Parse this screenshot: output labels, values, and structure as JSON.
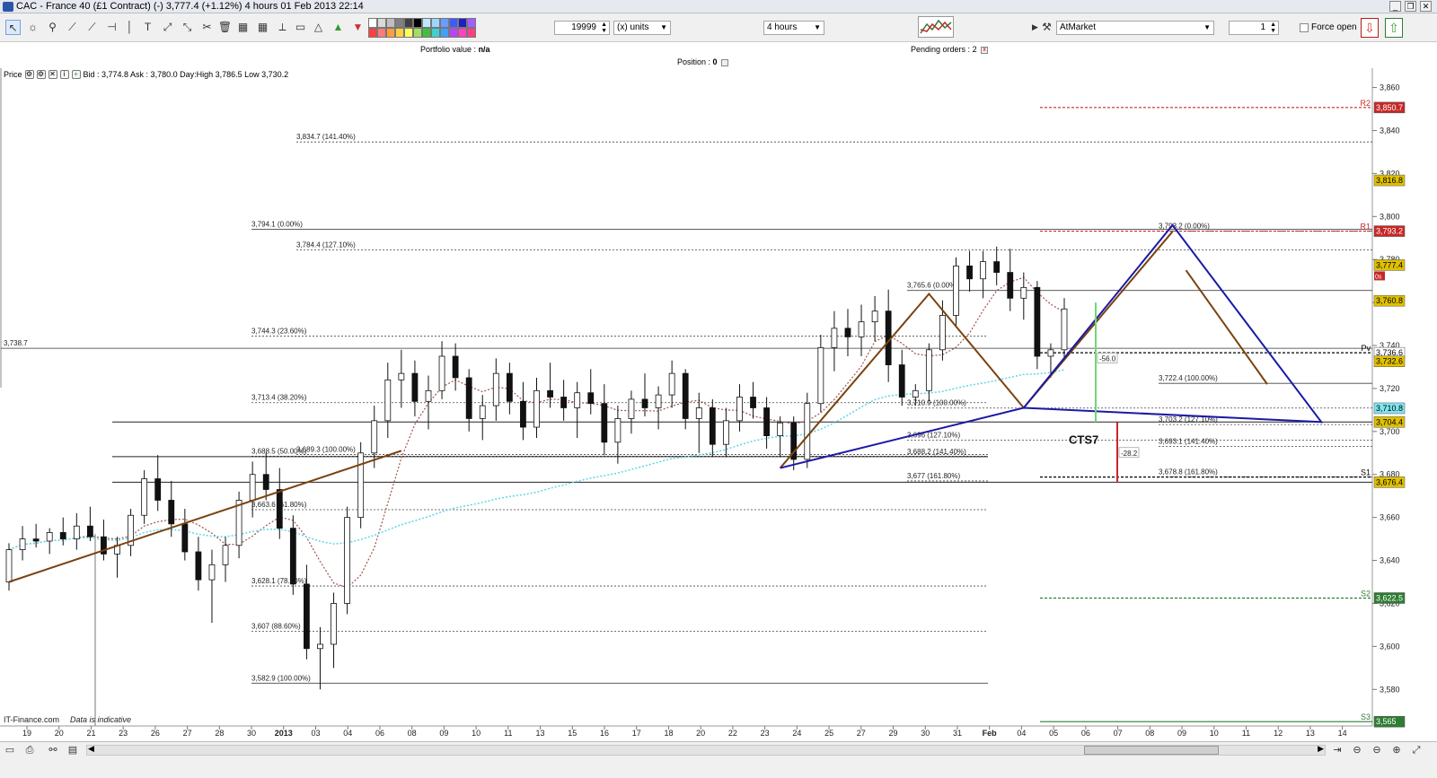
{
  "window": {
    "title": "CAC - France 40 (£1 Contract) (-)    3,777.4 (+1.12%)    4 hours  01 Feb 2013 22:14"
  },
  "toolbar": {
    "quantity": "19999",
    "units": "(x) units",
    "timeframe": "4 hours",
    "order_type": "AtMarket",
    "order_qty": "1",
    "force_open": "Force open"
  },
  "status": {
    "portfolio_label": "Portfolio value :",
    "portfolio_value": "n/a",
    "pending_label": "Pending orders :",
    "pending_value": "2",
    "position_label": "Position :",
    "position_value": "0"
  },
  "chart_header": {
    "label": "Price",
    "quote": "Bid : 3,774.8 Ask : 3,780.0 Day:High 3,786.5 Low 3,730.2"
  },
  "watermark": {
    "brand": "IT-Finance.com",
    "note": "Data is indicative"
  },
  "chart_data": {
    "type": "candlestick",
    "instrument": "CAC - France 40 (£1 Contract)",
    "timeframe": "4 hours",
    "y_ticks": [
      3580,
      3600,
      3620,
      3640,
      3660,
      3680,
      3700,
      3720,
      3740,
      3760,
      3780,
      3800,
      3820,
      3840,
      3860
    ],
    "y_tick_labels": [
      "3,580",
      "3,600",
      "3,620",
      "3,640",
      "3,660",
      "3,680",
      "3,700",
      "3,720",
      "3,740",
      "3,760",
      "3,780",
      "3,800",
      "3,820",
      "3,840",
      "3,860"
    ],
    "ylim": [
      3563,
      3869
    ],
    "x_labels": [
      "19",
      "20",
      "21",
      "23",
      "26",
      "27",
      "28",
      "30",
      "2013",
      "03",
      "04",
      "06",
      "08",
      "09",
      "10",
      "11",
      "13",
      "15",
      "16",
      "17",
      "18",
      "20",
      "22",
      "23",
      "24",
      "25",
      "27",
      "29",
      "30",
      "31",
      "Feb",
      "04",
      "05",
      "06",
      "07",
      "08",
      "09",
      "10",
      "11",
      "12",
      "13",
      "14"
    ],
    "candles": [
      [
        3630,
        3648,
        3626,
        3645
      ],
      [
        3645,
        3656,
        3640,
        3650
      ],
      [
        3650,
        3657,
        3646,
        3649
      ],
      [
        3649,
        3655,
        3643,
        3653
      ],
      [
        3653,
        3660,
        3647,
        3650
      ],
      [
        3650,
        3662,
        3645,
        3656
      ],
      [
        3656,
        3665,
        3649,
        3651
      ],
      [
        3651,
        3659,
        3640,
        3643
      ],
      [
        3643,
        3651,
        3632,
        3647
      ],
      [
        3647,
        3664,
        3642,
        3661
      ],
      [
        3661,
        3682,
        3657,
        3678
      ],
      [
        3678,
        3689,
        3663,
        3668
      ],
      [
        3668,
        3677,
        3651,
        3657
      ],
      [
        3657,
        3664,
        3640,
        3644
      ],
      [
        3644,
        3651,
        3626,
        3631
      ],
      [
        3631,
        3645,
        3611,
        3638
      ],
      [
        3638,
        3651,
        3630,
        3647
      ],
      [
        3647,
        3672,
        3641,
        3668
      ],
      [
        3668,
        3686,
        3660,
        3680
      ],
      [
        3680,
        3690,
        3668,
        3673
      ],
      [
        3673,
        3683,
        3650,
        3655
      ],
      [
        3655,
        3661,
        3624,
        3629
      ],
      [
        3629,
        3638,
        3594,
        3599
      ],
      [
        3599,
        3609,
        3580,
        3601
      ],
      [
        3601,
        3625,
        3590,
        3620
      ],
      [
        3620,
        3665,
        3615,
        3660
      ],
      [
        3660,
        3695,
        3655,
        3690
      ],
      [
        3690,
        3712,
        3683,
        3705
      ],
      [
        3705,
        3732,
        3697,
        3724
      ],
      [
        3724,
        3738,
        3711,
        3727
      ],
      [
        3727,
        3733,
        3707,
        3714
      ],
      [
        3714,
        3726,
        3701,
        3719
      ],
      [
        3719,
        3742,
        3715,
        3735
      ],
      [
        3735,
        3741,
        3719,
        3725
      ],
      [
        3725,
        3729,
        3700,
        3706
      ],
      [
        3706,
        3717,
        3696,
        3712
      ],
      [
        3712,
        3734,
        3705,
        3727
      ],
      [
        3727,
        3732,
        3708,
        3714
      ],
      [
        3714,
        3723,
        3696,
        3702
      ],
      [
        3702,
        3725,
        3697,
        3719
      ],
      [
        3719,
        3732,
        3711,
        3716
      ],
      [
        3716,
        3724,
        3705,
        3711
      ],
      [
        3711,
        3723,
        3697,
        3718
      ],
      [
        3718,
        3729,
        3708,
        3713
      ],
      [
        3713,
        3722,
        3689,
        3695
      ],
      [
        3695,
        3712,
        3685,
        3706
      ],
      [
        3706,
        3719,
        3699,
        3715
      ],
      [
        3715,
        3727,
        3707,
        3711
      ],
      [
        3711,
        3721,
        3701,
        3717
      ],
      [
        3717,
        3733,
        3711,
        3727
      ],
      [
        3727,
        3729,
        3701,
        3706
      ],
      [
        3706,
        3718,
        3690,
        3711
      ],
      [
        3711,
        3715,
        3688,
        3694
      ],
      [
        3694,
        3711,
        3688,
        3705
      ],
      [
        3705,
        3722,
        3700,
        3716
      ],
      [
        3716,
        3723,
        3706,
        3711
      ],
      [
        3711,
        3716,
        3692,
        3698
      ],
      [
        3698,
        3707,
        3688,
        3704
      ],
      [
        3704,
        3707,
        3682,
        3687
      ],
      [
        3687,
        3718,
        3683,
        3713
      ],
      [
        3713,
        3745,
        3709,
        3739
      ],
      [
        3739,
        3756,
        3728,
        3748
      ],
      [
        3748,
        3757,
        3735,
        3744
      ],
      [
        3744,
        3759,
        3735,
        3751
      ],
      [
        3751,
        3763,
        3742,
        3756
      ],
      [
        3756,
        3766,
        3723,
        3731
      ],
      [
        3731,
        3738,
        3712,
        3716
      ],
      [
        3716,
        3722,
        3712,
        3719
      ],
      [
        3719,
        3741,
        3714,
        3738
      ],
      [
        3738,
        3761,
        3733,
        3754
      ],
      [
        3754,
        3781,
        3749,
        3777
      ],
      [
        3777,
        3784,
        3765,
        3771
      ],
      [
        3771,
        3784,
        3762,
        3779
      ],
      [
        3779,
        3786,
        3768,
        3774
      ],
      [
        3774,
        3785,
        3756,
        3762
      ],
      [
        3762,
        3774,
        3752,
        3767
      ],
      [
        3767,
        3770,
        3729,
        3735
      ],
      [
        3735,
        3741,
        3725,
        3738
      ],
      [
        3738,
        3762,
        3733,
        3757
      ]
    ],
    "fib_levels": [
      {
        "value": 3834.7,
        "label": "3,834.7 (141.40%)"
      },
      {
        "value": 3794.1,
        "label": "3,794.1 (0.00%)"
      },
      {
        "value": 3784.4,
        "label": "3,784.4 (127.10%)"
      },
      {
        "value": 3765.6,
        "label": "3,765.6 (0.00%)"
      },
      {
        "value": 3744.3,
        "label": "3,744.3 (23.60%)"
      },
      {
        "value": 3713.4,
        "label": "3,713.4 (38.20%)"
      },
      {
        "value": 3710.9,
        "label": "3,710.9 (100.00%)"
      },
      {
        "value": 3703.2,
        "label": "3,703.2 (127.10%)"
      },
      {
        "value": 3696,
        "label": "3,696 (127.10%)"
      },
      {
        "value": 3693.1,
        "label": "3,693.1 (141.40%)"
      },
      {
        "value": 3689.3,
        "label": "3,689.3 (100.00%)"
      },
      {
        "value": 3688.5,
        "label": "3,688.5 (50.00%)"
      },
      {
        "value": 3688.2,
        "label": "3,688.2 (141.40%)"
      },
      {
        "value": 3678.8,
        "label": "3,678.8 (161.80%)"
      },
      {
        "value": 3677,
        "label": "3,677 (161.80%)"
      },
      {
        "value": 3663.6,
        "label": "3,663.6 (61.80%)"
      },
      {
        "value": 3628.1,
        "label": "3,628.1 (78.60%)"
      },
      {
        "value": 3607,
        "label": "3,607 (88.60%)"
      },
      {
        "value": 3582.9,
        "label": "3,582.9 (100.00%)"
      },
      {
        "value": 3793.2,
        "label": "3,793.2 (0.00%)"
      },
      {
        "value": 3722.4,
        "label": "3,722.4 (100.00%)"
      }
    ],
    "price_tags": [
      {
        "value": 3850.7,
        "label": "3,850.7",
        "color": "#c62828"
      },
      {
        "value": 3816.8,
        "label": "3,816.8",
        "color": "#e0c000"
      },
      {
        "value": 3793.2,
        "label": "3,793.2",
        "color": "#c62828"
      },
      {
        "value": 3777.4,
        "label": "3,777.4",
        "color": "#e0c000"
      },
      {
        "value": 3760.8,
        "label": "3,760.8",
        "color": "#e0c000"
      },
      {
        "value": 3736.6,
        "label": "3,736.6",
        "color": "#ffffff"
      },
      {
        "value": 3732.6,
        "label": "3,732.6",
        "color": "#e0c000"
      },
      {
        "value": 3710.8,
        "label": "3,710.8",
        "color": "#7fe6f0"
      },
      {
        "value": 3704.4,
        "label": "3,704.4",
        "color": "#e0c000"
      },
      {
        "value": 3676.4,
        "label": "3,676.4",
        "color": "#e0c000"
      },
      {
        "value": 3622.5,
        "label": "3,622.5",
        "color": "#2e7d32"
      },
      {
        "value": 3565,
        "label": "3,565",
        "color": "#2e7d32"
      }
    ],
    "pivots": [
      {
        "name": "R2",
        "value": 3850.7,
        "color": "#c62828"
      },
      {
        "name": "R1",
        "value": 3793.2,
        "color": "#c62828"
      },
      {
        "name": "Pv",
        "value": 3736.6,
        "color": "#000000"
      },
      {
        "name": "S1",
        "value": 3678.8,
        "color": "#000000"
      },
      {
        "name": "S2",
        "value": 3622.5,
        "color": "#2e7d32"
      },
      {
        "name": "S3",
        "value": 3565,
        "color": "#2e7d32"
      }
    ],
    "left_level": {
      "value": 3738.7,
      "label": "3,738.7"
    },
    "annotations": {
      "cts7": "CTS7",
      "green_move": "-56.0",
      "red_move": "-28.2",
      "tag_os": "0s"
    },
    "colors": {
      "pattern_blue": "#1a1aa6",
      "pattern_brown": "#7a4210",
      "ma_slow": "#5fd6e6",
      "ma_fast": "#a0524c",
      "pivot_red": "#c62828",
      "pivot_green": "#2e7d32"
    }
  }
}
